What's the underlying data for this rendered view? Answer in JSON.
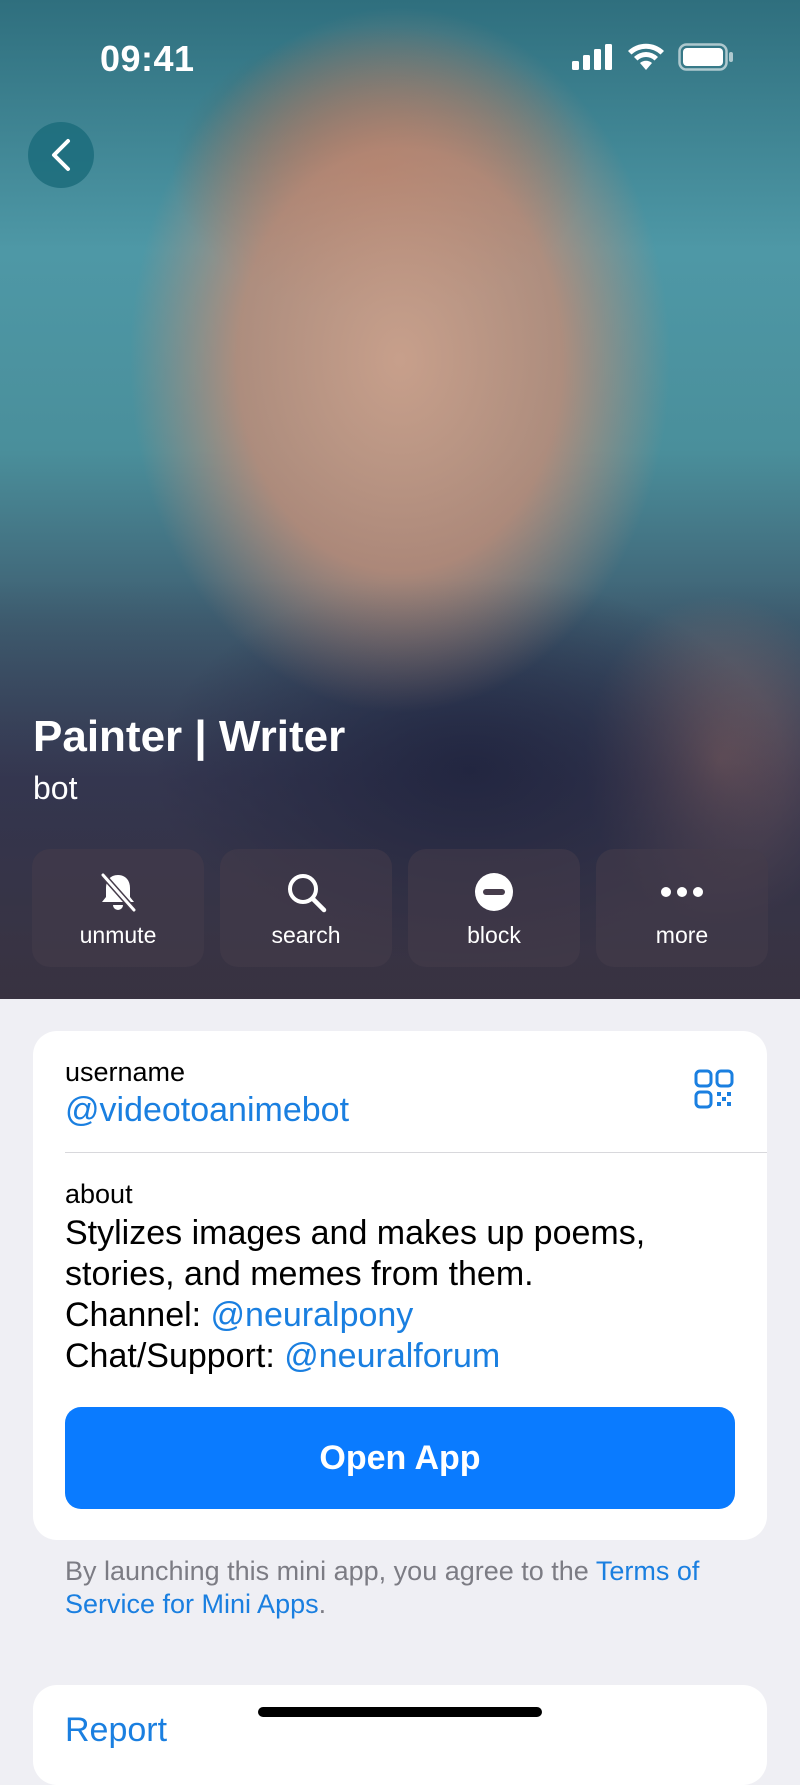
{
  "status_bar": {
    "time": "09:41"
  },
  "profile": {
    "name": "Painter | Writer",
    "type": "bot"
  },
  "actions": [
    {
      "label": "unmute",
      "icon": "bell-slash-icon"
    },
    {
      "label": "search",
      "icon": "search-icon"
    },
    {
      "label": "block",
      "icon": "block-icon"
    },
    {
      "label": "more",
      "icon": "more-icon"
    }
  ],
  "info": {
    "username_label": "username",
    "username": "@videotoanimebot",
    "about_label": "about",
    "about_line1": "Stylizes images and makes up poems,",
    "about_line2": "stories, and memes from them.",
    "channel_prefix": "Channel: ",
    "channel_link": "@neuralpony",
    "support_prefix": "Chat/Support: ",
    "support_link": "@neuralforum",
    "open_app": "Open App"
  },
  "disclaimer": {
    "text": "By launching this mini app, you agree to the ",
    "link": "Terms of Service for Mini Apps",
    "end": "."
  },
  "report": "Report",
  "colors": {
    "accent": "#0a7bff",
    "link": "#1a7fe0",
    "background": "#efeff4"
  }
}
